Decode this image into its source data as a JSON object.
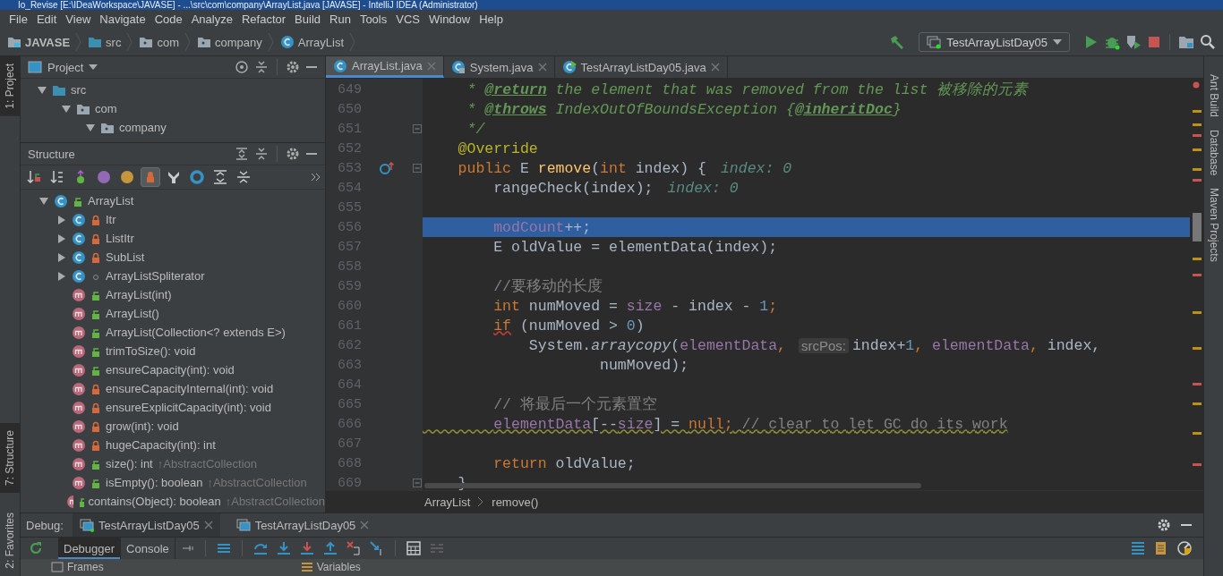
{
  "title_bar": {
    "text": "Io_Revise [E:\\IDeaWorkspace\\JAVASE] - ...\\src\\com\\company\\ArrayList.java [JAVASE] - IntelliJ IDEA (Administrator)"
  },
  "menu": [
    "File",
    "Edit",
    "View",
    "Navigate",
    "Code",
    "Analyze",
    "Refactor",
    "Build",
    "Run",
    "Tools",
    "VCS",
    "Window",
    "Help"
  ],
  "nav_bar": {
    "crumbs": [
      {
        "label": "JAVASE",
        "kind": "module"
      },
      {
        "label": "src",
        "kind": "source-folder"
      },
      {
        "label": "com",
        "kind": "package"
      },
      {
        "label": "company",
        "kind": "package"
      },
      {
        "label": "ArrayList",
        "kind": "class"
      }
    ],
    "run_config": "TestArrayListDay05"
  },
  "left_stripe": [
    {
      "label": "1: Project",
      "selected": true,
      "kind": "top"
    },
    {
      "label": "7: Structure",
      "selected": true,
      "kind": "middle"
    },
    {
      "label": "2: Favorites",
      "selected": false,
      "kind": "bottom"
    }
  ],
  "project_panel": {
    "title": "Project",
    "tree": [
      {
        "label": "src",
        "kind": "source-folder",
        "expanded": true,
        "children": [
          {
            "label": "com",
            "kind": "package",
            "expanded": true,
            "children": [
              {
                "label": "company",
                "kind": "package",
                "expanded": true
              }
            ]
          }
        ]
      }
    ]
  },
  "structure_panel": {
    "title": "Structure",
    "toolbar": [
      {
        "kind": "sort-visibility",
        "selected": false
      },
      {
        "kind": "sort-alpha",
        "selected": false
      },
      {
        "kind": "inherited",
        "selected": false
      },
      {
        "kind": "properties",
        "selected": false
      },
      {
        "kind": "fields",
        "selected": false
      },
      {
        "kind": "non-public",
        "selected": true
      },
      {
        "kind": "anonymous",
        "selected": false
      },
      {
        "kind": "lambdas",
        "selected": false
      },
      {
        "kind": "expand",
        "selected": false
      },
      {
        "kind": "collapse",
        "selected": false
      }
    ],
    "tree": [
      {
        "label": "ArrayList",
        "kind": "public-class",
        "expanded": true,
        "children": [
          {
            "label": "Itr",
            "kind": "private-class",
            "expanded": false
          },
          {
            "label": "ListItr",
            "kind": "private-class",
            "expanded": false
          },
          {
            "label": "SubList",
            "kind": "private-class",
            "expanded": false
          },
          {
            "label": "ArrayListSpliterator",
            "kind": "package-class",
            "expanded": false
          },
          {
            "label": "ArrayList(int)",
            "kind": "public-method"
          },
          {
            "label": "ArrayList()",
            "kind": "public-method"
          },
          {
            "label": "ArrayList(Collection<? extends E>)",
            "kind": "public-method"
          },
          {
            "label": "trimToSize(): void",
            "kind": "public-method"
          },
          {
            "label": "ensureCapacity(int): void",
            "kind": "public-method"
          },
          {
            "label": "ensureCapacityInternal(int): void",
            "kind": "private-method"
          },
          {
            "label": "ensureExplicitCapacity(int): void",
            "kind": "private-method"
          },
          {
            "label": "grow(int): void",
            "kind": "private-method"
          },
          {
            "label": "hugeCapacity(int): int",
            "kind": "private-method"
          },
          {
            "label": "size(): int",
            "kind": "public-method",
            "inherited": "↑AbstractCollection"
          },
          {
            "label": "isEmpty(): boolean",
            "kind": "public-method",
            "inherited": "↑AbstractCollection"
          },
          {
            "label": "contains(Object): boolean",
            "kind": "public-method",
            "inherited": "↑AbstractCollection"
          }
        ]
      }
    ]
  },
  "editor": {
    "tabs": [
      {
        "label": "ArrayList.java",
        "kind": "class",
        "selected": true
      },
      {
        "label": "System.java",
        "kind": "locked-class",
        "selected": false
      },
      {
        "label": "TestArrayListDay05.java",
        "kind": "runnable-class",
        "selected": false
      }
    ],
    "lines": [
      {
        "number": "649",
        "highlighted": false,
        "tokens": [
          {
            "text": "     * ",
            "kind": "doc"
          },
          {
            "text": "@return",
            "kind": "doctag"
          },
          {
            "text": " the element that was removed from the list 被移除的元素",
            "kind": "doc"
          }
        ]
      },
      {
        "number": "650",
        "highlighted": false,
        "tokens": [
          {
            "text": "     * ",
            "kind": "doc"
          },
          {
            "text": "@throws",
            "kind": "doctag"
          },
          {
            "text": " IndexOutOfBoundsException {",
            "kind": "doc"
          },
          {
            "text": "@inheritDoc",
            "kind": "doctag"
          },
          {
            "text": "}",
            "kind": "doc"
          }
        ]
      },
      {
        "number": "651",
        "highlighted": false,
        "fold": true,
        "tokens": [
          {
            "text": "     */",
            "kind": "doc"
          }
        ]
      },
      {
        "number": "652",
        "highlighted": false,
        "tokens": [
          {
            "text": "    @Override",
            "kind": "annotation"
          }
        ]
      },
      {
        "number": "653",
        "highlighted": false,
        "fold": true,
        "implements_marker": true,
        "tokens": [
          {
            "text": "    public",
            "kind": "keyword"
          },
          {
            "text": " E ",
            "kind": "plain"
          },
          {
            "text": "remove",
            "kind": "declaration"
          },
          {
            "text": "(",
            "kind": "plain"
          },
          {
            "text": "int",
            "kind": "keyword"
          },
          {
            "text": " index) {",
            "kind": "plain"
          },
          {
            "text": "index: 0",
            "kind": "value-hint"
          }
        ]
      },
      {
        "number": "654",
        "highlighted": false,
        "tokens": [
          {
            "text": "        rangeCheck(index);",
            "kind": "plain"
          },
          {
            "text": "index: 0",
            "kind": "value-hint"
          }
        ]
      },
      {
        "number": "655",
        "highlighted": false
      },
      {
        "number": "656",
        "highlighted": true,
        "tokens": [
          {
            "text": "        modCount",
            "kind": "field"
          },
          {
            "text": "++;",
            "kind": "plain"
          }
        ]
      },
      {
        "number": "657",
        "highlighted": false,
        "tokens": [
          {
            "text": "        E oldValue = elementData(index);",
            "kind": "plain"
          }
        ]
      },
      {
        "number": "658",
        "highlighted": false
      },
      {
        "number": "659",
        "highlighted": false,
        "tokens": [
          {
            "text": "        //要移动的长度",
            "kind": "comment"
          }
        ]
      },
      {
        "number": "660",
        "highlighted": false,
        "tokens": [
          {
            "text": "        int",
            "kind": "keyword"
          },
          {
            "text": " numMoved = ",
            "kind": "plain"
          },
          {
            "text": "size",
            "kind": "field"
          },
          {
            "text": " - index - ",
            "kind": "plain"
          },
          {
            "text": "1",
            "kind": "number"
          },
          {
            "text": ";",
            "kind": "keyword"
          }
        ]
      },
      {
        "number": "661",
        "highlighted": false,
        "tokens": [
          {
            "text": "        if",
            "kind": "keyword",
            "error": true
          },
          {
            "text": " (numMoved > ",
            "kind": "plain"
          },
          {
            "text": "0",
            "kind": "number"
          },
          {
            "text": ")",
            "kind": "plain"
          }
        ]
      },
      {
        "number": "662",
        "highlighted": false,
        "tokens": [
          {
            "text": "            System.",
            "kind": "plain"
          },
          {
            "text": "arraycopy",
            "kind": "static-call"
          },
          {
            "text": "(",
            "kind": "plain"
          },
          {
            "text": "elementData",
            "kind": "field"
          },
          {
            "text": ", ",
            "kind": "keyword"
          },
          {
            "text": "srcPos:",
            "kind": "parameter-hint"
          },
          {
            "text": "index+",
            "kind": "plain"
          },
          {
            "text": "1",
            "kind": "number"
          },
          {
            "text": ", ",
            "kind": "keyword"
          },
          {
            "text": "elementData",
            "kind": "field"
          },
          {
            "text": ", ",
            "kind": "keyword"
          },
          {
            "text": "index,",
            "kind": "plain"
          }
        ]
      },
      {
        "number": "663",
        "highlighted": false,
        "tokens": [
          {
            "text": "                    numMoved);",
            "kind": "plain"
          }
        ]
      },
      {
        "number": "664",
        "highlighted": false
      },
      {
        "number": "665",
        "highlighted": false,
        "tokens": [
          {
            "text": "        // 将最后一个元素置空",
            "kind": "comment"
          }
        ]
      },
      {
        "number": "666",
        "highlighted": false,
        "warning": true,
        "tokens": [
          {
            "text": "        elementData",
            "kind": "field"
          },
          {
            "text": "[--",
            "kind": "plain"
          },
          {
            "text": "size",
            "kind": "field"
          },
          {
            "text": "] = ",
            "kind": "plain"
          },
          {
            "text": "null;",
            "kind": "keyword"
          },
          {
            "text": " // clear to let GC do its work",
            "kind": "comment"
          }
        ]
      },
      {
        "number": "667",
        "highlighted": false
      },
      {
        "number": "668",
        "highlighted": false,
        "tokens": [
          {
            "text": "        return",
            "kind": "keyword"
          },
          {
            "text": " oldValue;",
            "kind": "plain"
          }
        ]
      },
      {
        "number": "669",
        "highlighted": false,
        "fold": true,
        "tokens": [
          {
            "text": "    }",
            "kind": "plain"
          }
        ]
      }
    ],
    "breadcrumbs": [
      "ArrayList",
      "remove()"
    ]
  },
  "right_stripe": [
    "Ant Build",
    "Database",
    "Maven Projects"
  ],
  "debug": {
    "label": "Debug:",
    "sessions": [
      {
        "label": "TestArrayListDay05",
        "selected": true
      },
      {
        "label": "TestArrayListDay05",
        "selected": false
      }
    ],
    "tabs": [
      {
        "label": "Debugger",
        "selected": true
      },
      {
        "label": "Console",
        "selected": false
      }
    ],
    "panes": [
      "Frames",
      "Variables"
    ]
  }
}
